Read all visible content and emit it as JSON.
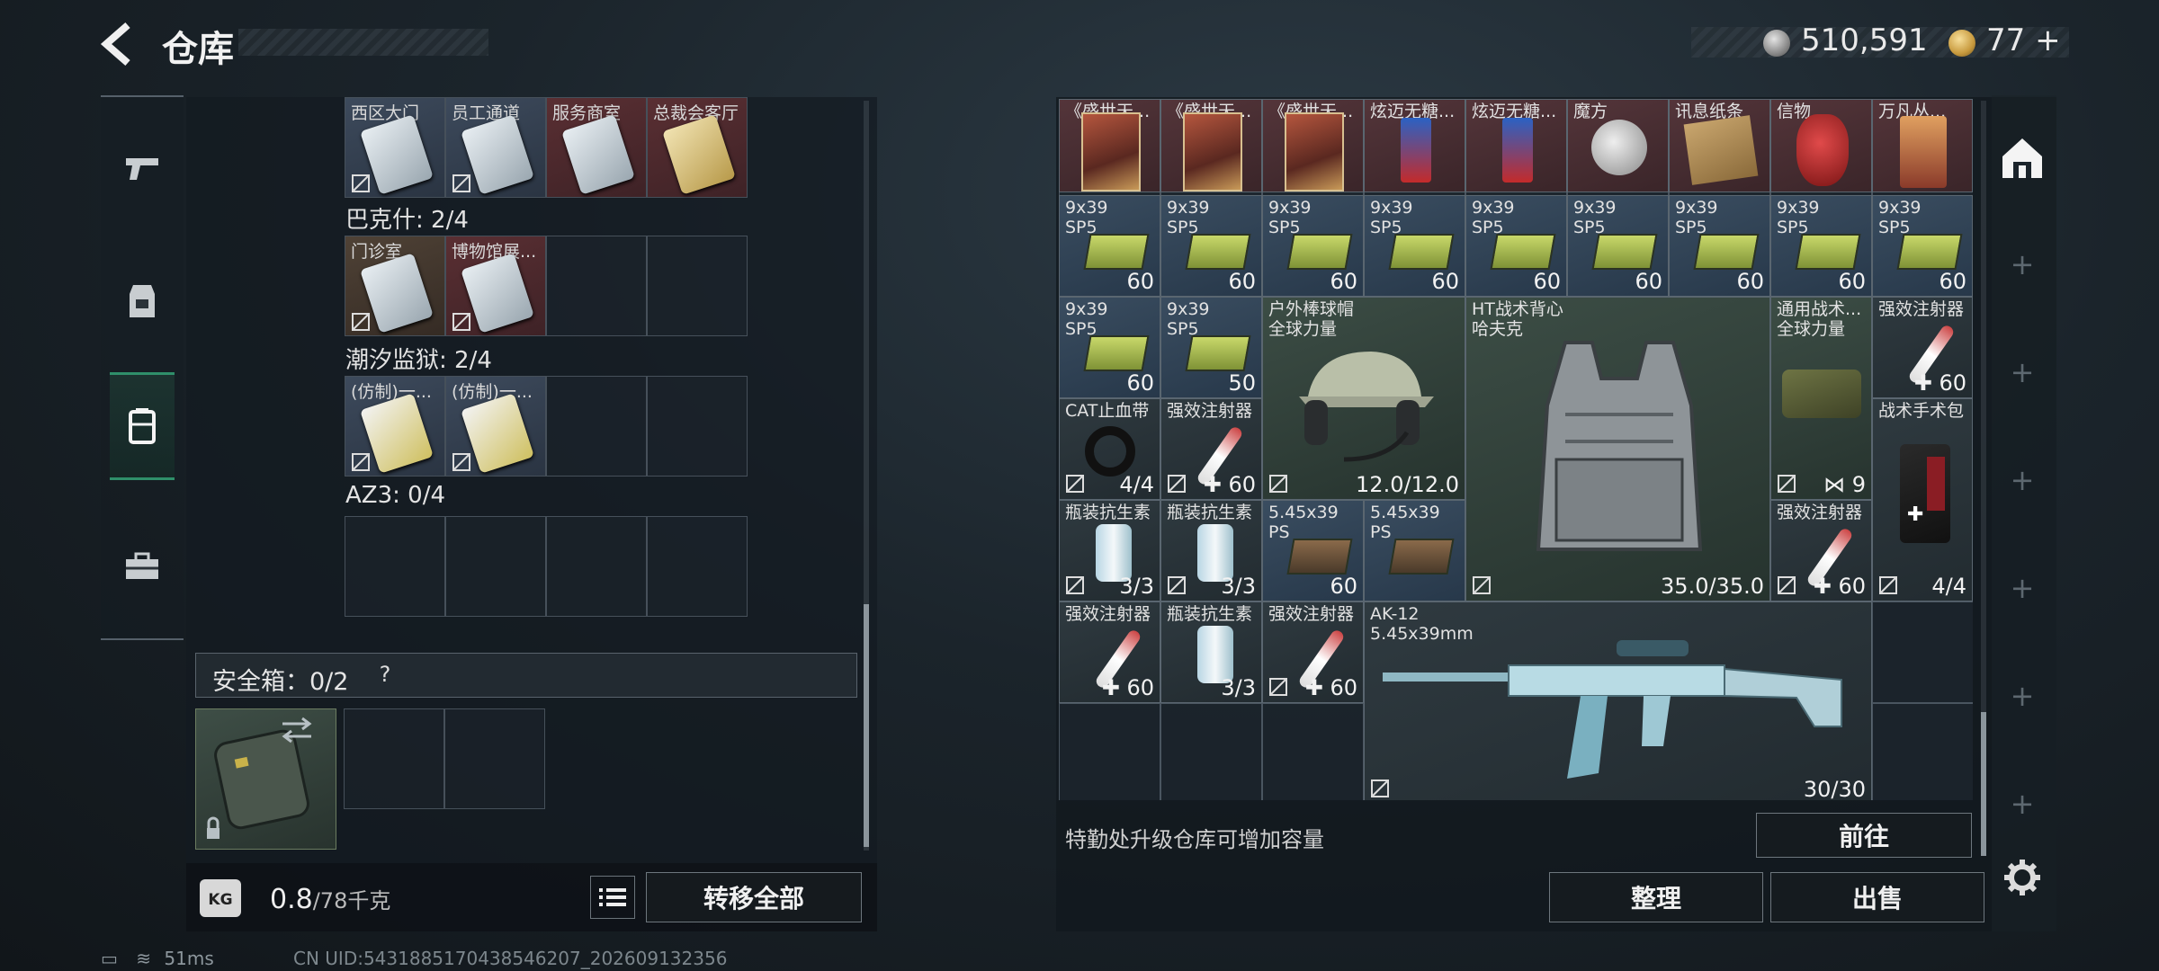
{
  "header": {
    "title": "仓库",
    "silver_value": "510,591",
    "gold_value": "77 +"
  },
  "nav": {
    "tabs": [
      {
        "name": "weapon",
        "icon": "pistol-icon"
      },
      {
        "name": "armor",
        "icon": "backpack-gear-icon"
      },
      {
        "name": "pack",
        "icon": "container-icon",
        "active": true
      },
      {
        "name": "toolbox",
        "icon": "briefcase-icon"
      }
    ]
  },
  "left": {
    "top_row_labels": [
      "西区大门",
      "员工通道",
      "服务商室",
      "总裁会客厅"
    ],
    "groups": [
      {
        "label": "巴克什: 2/4",
        "items": [
          "门诊室",
          "博物馆展..."
        ]
      },
      {
        "label": "潮汐监狱: 2/4",
        "items": [
          "(仿制)一...",
          "(仿制)一..."
        ]
      },
      {
        "label": "AZ3: 0/4",
        "items": []
      }
    ],
    "safebox_label": "安全箱：0/2",
    "safebox_help": "?",
    "weight_value": "0.8",
    "weight_max": "/78千克",
    "kg_label": "KG",
    "transfer_all": "转移全部"
  },
  "stash": {
    "row0_labels": [
      "《盛世天...",
      "《盛世天...",
      "《盛世天...",
      "炫迈无糖...",
      "炫迈无糖...",
      "魔方",
      "讯息纸条",
      "信物",
      "万凡丛..."
    ],
    "ammo_name": "9x39\nSP5",
    "ammo_counts": [
      "60",
      "60",
      "60",
      "60",
      "60",
      "60",
      "60",
      "60",
      "60",
      "60",
      "50"
    ],
    "cap_name": "户外棒球帽\n全球力量",
    "cap_durability": "12.0/12.0",
    "vest_name": "HT战术背心\n哈夫克",
    "vest_durability": "35.0/35.0",
    "general_tactical_name": "通用战术...\n全球力量",
    "general_tactical_count": "9",
    "stim_name": "强效注射器",
    "stim_count": "60",
    "cat_name": "CAT止血带",
    "cat_count": "4/4",
    "antibiotic_name": "瓶装抗生素",
    "antibiotic_count": "3/3",
    "ps_ammo_name": "5.45x39\nPS",
    "ps_ammo_count": "60",
    "medkit_name": "战术手术包",
    "medkit_count": "4/4",
    "rifle_name": "AK-12\n5.45x39mm",
    "rifle_ammo": "30/30",
    "upgrade_hint": "特勤处升级仓库可增加容量",
    "goto": "前往",
    "sort": "整理",
    "sell": "出售"
  },
  "status": {
    "ping": "51ms",
    "uid": "CN UID:5431885170438546207_202609132356"
  },
  "colors": {
    "accent_green": "#2f8f6a",
    "panel": "#141b21",
    "border": "#46505a"
  }
}
